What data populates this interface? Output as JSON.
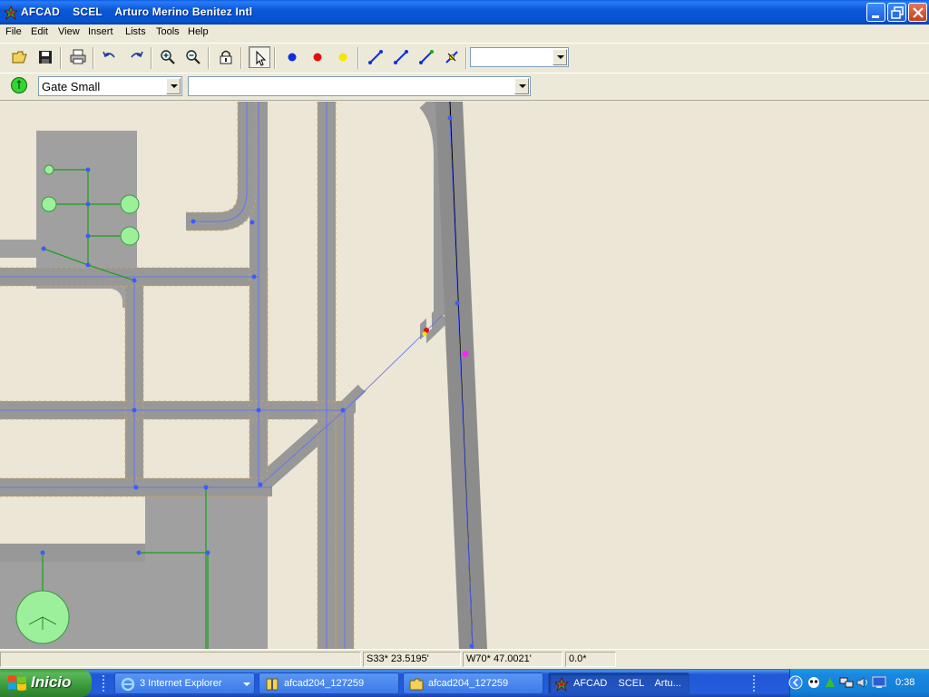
{
  "window": {
    "title": "AFCAD    SCEL    Arturo Merino Benitez Intl"
  },
  "menu": [
    "File",
    "Edit",
    "View",
    "Insert",
    "Lists",
    "Tools",
    "Help"
  ],
  "toolbar": {
    "buttons": [
      "open-icon",
      "save-icon",
      "print-icon",
      "undo-icon",
      "redo-icon",
      "zoom-in-icon",
      "zoom-out-icon",
      "lock-icon",
      "select-arrow-icon",
      "blue-node-icon",
      "red-node-icon",
      "yellow-node-icon",
      "link-blue-icon",
      "link-blue-2-icon",
      "link-green-icon",
      "link-split-icon"
    ],
    "layer_combo_value": ""
  },
  "toolbar2": {
    "parking_type_value": "Gate Small",
    "secondary_combo_value": ""
  },
  "status": {
    "latitude": "S33* 23.5195'",
    "longitude": "W70* 47.0021'",
    "heading": "0.0*"
  },
  "taskbar": {
    "start_label": "Inicio",
    "tasks": [
      {
        "label": "3 Internet Explorer",
        "icon": "internet-explorer-icon"
      },
      {
        "label": "afcad204_127259",
        "icon": "zip-icon"
      },
      {
        "label": "afcad204_127259",
        "icon": "folder-icon"
      },
      {
        "label": "AFCAD    SCEL    Artu...",
        "icon": "afcad-icon"
      }
    ],
    "clock": "0:38"
  },
  "colors": {
    "map_background": "#ebe6d6",
    "taxiway": "#989898",
    "node": "#3a5cff",
    "parking": "#9cf09c",
    "runway_centerline": "#000000"
  }
}
